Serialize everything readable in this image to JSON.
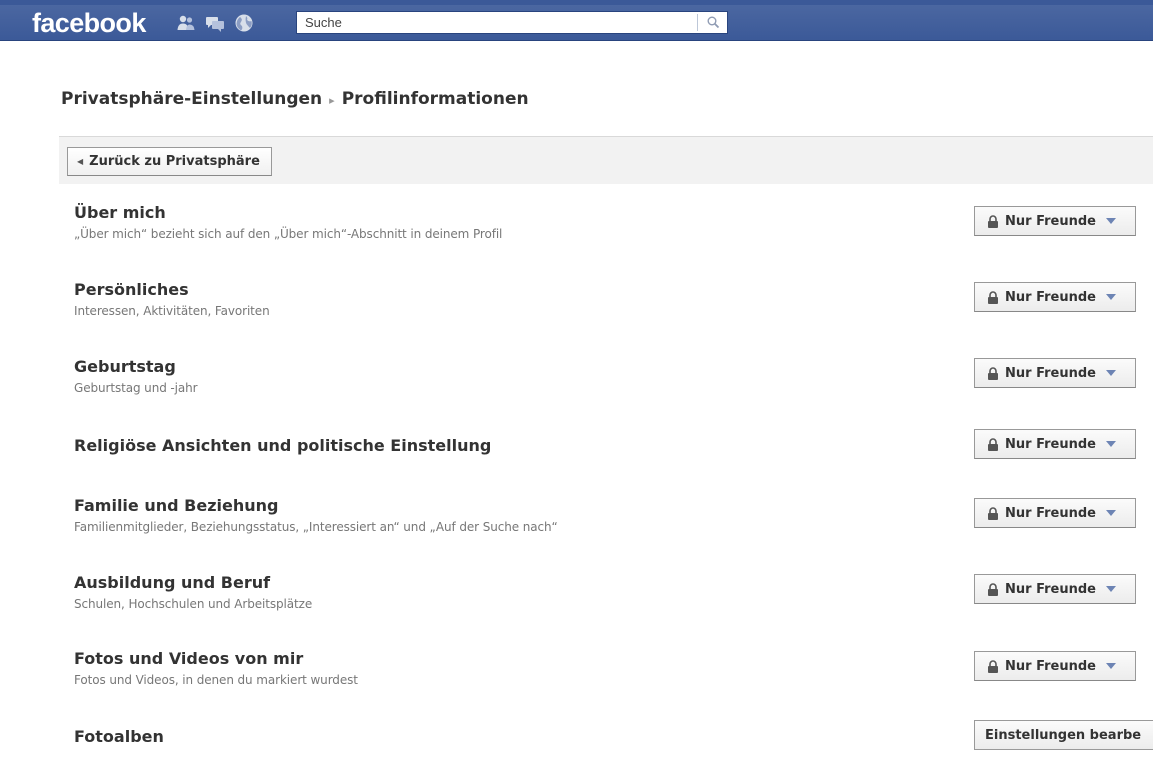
{
  "header": {
    "logo_text": "facebook",
    "jewels": [
      "friend-requests-icon",
      "messages-icon",
      "notifications-globe-icon"
    ],
    "search": {
      "placeholder": "Suche",
      "value": ""
    },
    "brand_color": "#3b5998"
  },
  "breadcrumb": {
    "parent": "Privatsphäre-Einstellungen",
    "separator": "▸",
    "current": "Profilinformationen"
  },
  "back_button": {
    "label": "Zurück zu Privatsphäre"
  },
  "settings": [
    {
      "title": "Über mich",
      "description": "„Über mich“ bezieht sich auf den „Über mich“-Abschnitt in deinem Profil",
      "privacy": "Nur Freunde"
    },
    {
      "title": "Persönliches",
      "description": "Interessen, Aktivitäten, Favoriten",
      "privacy": "Nur Freunde"
    },
    {
      "title": "Geburtstag",
      "description": "Geburtstag und -jahr",
      "privacy": "Nur Freunde"
    },
    {
      "title": "Religiöse Ansichten und politische Einstellung",
      "description": "",
      "privacy": "Nur Freunde"
    },
    {
      "title": "Familie und Beziehung",
      "description": "Familienmitglieder, Beziehungsstatus, „Interessiert an“ und „Auf der Suche nach“",
      "privacy": "Nur Freunde"
    },
    {
      "title": "Ausbildung und Beruf",
      "description": "Schulen, Hochschulen und Arbeitsplätze",
      "privacy": "Nur Freunde"
    },
    {
      "title": "Fotos und Videos von mir",
      "description": "Fotos und Videos, in denen du markiert wurdest",
      "privacy": "Nur Freunde"
    },
    {
      "title": "Fotoalben",
      "description": "",
      "button": "Einstellungen bearbe"
    }
  ]
}
